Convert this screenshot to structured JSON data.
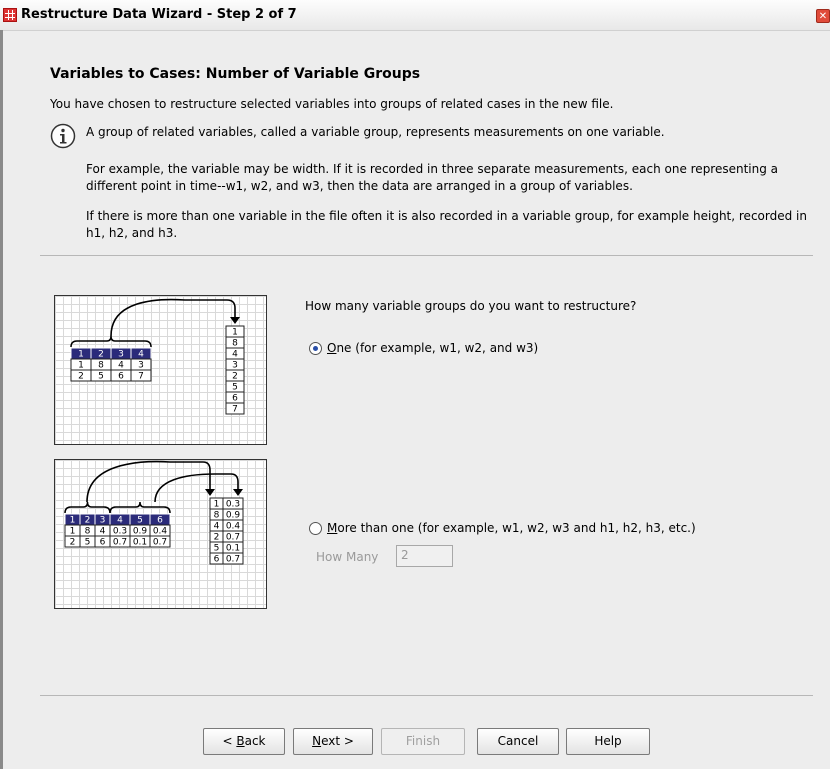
{
  "window": {
    "title": "Restructure Data Wizard - Step 2 of 7"
  },
  "header": {
    "heading": "Variables to Cases: Number of Variable Groups",
    "intro": "You have chosen to restructure selected variables into groups of related cases in the new file."
  },
  "info": {
    "p1": "A group of related variables, called a variable group, represents measurements on one variable.",
    "p2": "For example, the variable may be width. If it is recorded in three separate measurements, each one representing a different point in time--w1, w2, and w3, then the data are arranged in a group of variables.",
    "p3": "If there is more than one variable in the file often it is also recorded in a variable group, for example height, recorded in h1, h2, and h3."
  },
  "diagram1": {
    "header": [
      "1",
      "2",
      "3",
      "4"
    ],
    "rows": [
      [
        "1",
        "8",
        "4",
        "3"
      ],
      [
        "2",
        "5",
        "6",
        "7"
      ]
    ],
    "column": [
      "1",
      "8",
      "4",
      "3",
      "2",
      "5",
      "6",
      "7"
    ]
  },
  "diagram2": {
    "header": [
      "1",
      "2",
      "3",
      "4",
      "5",
      "6"
    ],
    "rows": [
      [
        "1",
        "8",
        "4",
        "0.3",
        "0.9",
        "0.4"
      ],
      [
        "2",
        "5",
        "6",
        "0.7",
        "0.1",
        "0.7"
      ]
    ],
    "column": [
      [
        "1",
        "0.3"
      ],
      [
        "8",
        "0.9"
      ],
      [
        "4",
        "0.4"
      ],
      [
        "2",
        "0.7"
      ],
      [
        "5",
        "0.1"
      ],
      [
        "6",
        "0.7"
      ]
    ]
  },
  "question": "How many variable groups do you want to restructure?",
  "options": {
    "one": {
      "mnemonic": "O",
      "rest": "ne (for example, w1, w2, and w3)",
      "selected": true
    },
    "more": {
      "mnemonic": "M",
      "rest": "ore than one (for example, w1, w2, w3 and h1, h2, h3, etc.)",
      "selected": false
    },
    "how_many_label": "How Many",
    "how_many_value": "2"
  },
  "buttons": {
    "back_prefix": "< ",
    "back_mnemonic": "B",
    "back_rest": "ack",
    "next_mnemonic": "N",
    "next_rest": "ext >",
    "finish": "Finish",
    "cancel": "Cancel",
    "help": "Help"
  },
  "colors": {
    "header_cell": "#2b2b7a",
    "radio_dot": "#2a4fa8"
  }
}
